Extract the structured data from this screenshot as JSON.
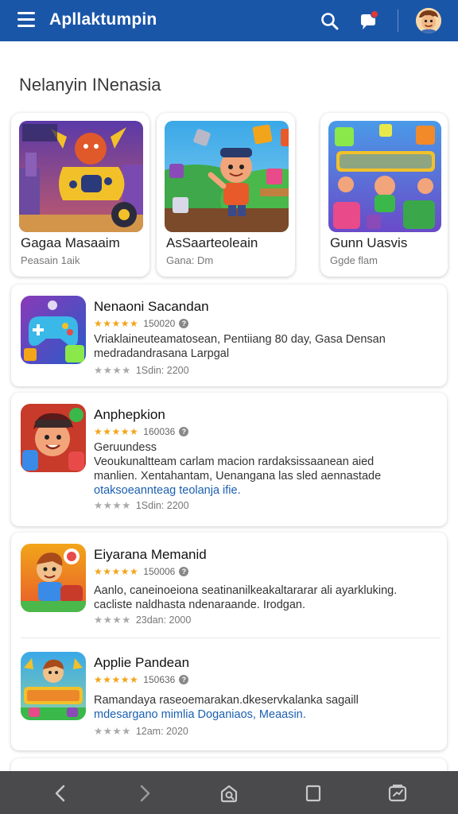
{
  "app": {
    "title": "Apllaktumpin",
    "notification_badge": "!"
  },
  "section": {
    "title": "Nelanyin INenasia"
  },
  "featured": [
    {
      "name": "Gagaa Masaaim",
      "subtitle": "Peasain 1aik"
    },
    {
      "name": "AsSaarteoleain",
      "subtitle": "Gana: Dm"
    },
    {
      "name": "Gunn Uasvis",
      "subtitle": "Ggde flam"
    }
  ],
  "list": [
    {
      "name": "Nenaoni Sacandan",
      "rating": 4.5,
      "stars": "★★★★★",
      "rating_count": "150020",
      "desc": [
        "Vriaklaineuteamatosean, Pentiiang 80 day, Gasa Densan",
        "medradandrasana Larpgal"
      ],
      "foot_stars": "★★★★",
      "foot": "1Sdin: 2200"
    },
    {
      "name": "Anphepkion",
      "rating": 4.5,
      "stars": "★★★★★",
      "rating_count": "160036",
      "desc": [
        "Geruundess",
        "Veoukunaltteam carlam macion rardaksissaanean aied",
        "manlien. Xentahantam, Uenangana las sled aennastade"
      ],
      "link": "otaksoeannteag teolanja ifie.",
      "foot_stars": "★★★★",
      "foot": "1Sdin: 2200"
    },
    {
      "name": "Eiyarana Memanid",
      "rating": 4.5,
      "stars": "★★★★★",
      "rating_count": "150006",
      "desc": [
        "Aanlo, caneinoeiona seatinanilkeakaltararar ali ayarkluking.",
        "cacliste naldhasta ndenaraande. Irodgan."
      ],
      "foot_stars": "★★★★",
      "foot": "23dan: 2000"
    },
    {
      "name": "Applie Pandean",
      "rating": 4.5,
      "stars": "★★★★★",
      "rating_count": "150636",
      "desc": [
        "Ramandaya raseoemarakan.dkeservkalanka sagaill"
      ],
      "link": "mdesargano mimlia Doganiaos, Meaasin.",
      "foot_stars": "★★★★",
      "foot": "12am: 2020"
    }
  ],
  "colors": {
    "appbar": "#1a56a8",
    "star": "#f2a51a",
    "link": "#1a5fb0",
    "bottomnav": "#4a4a4c"
  },
  "icons": {
    "menu": "menu-icon",
    "search": "search-icon",
    "notifications": "chat-bubble-icon",
    "back": "chevron-left-icon",
    "forward": "chevron-right-icon",
    "home": "home-icon",
    "tabs": "tabs-icon",
    "recents": "recents-icon"
  }
}
